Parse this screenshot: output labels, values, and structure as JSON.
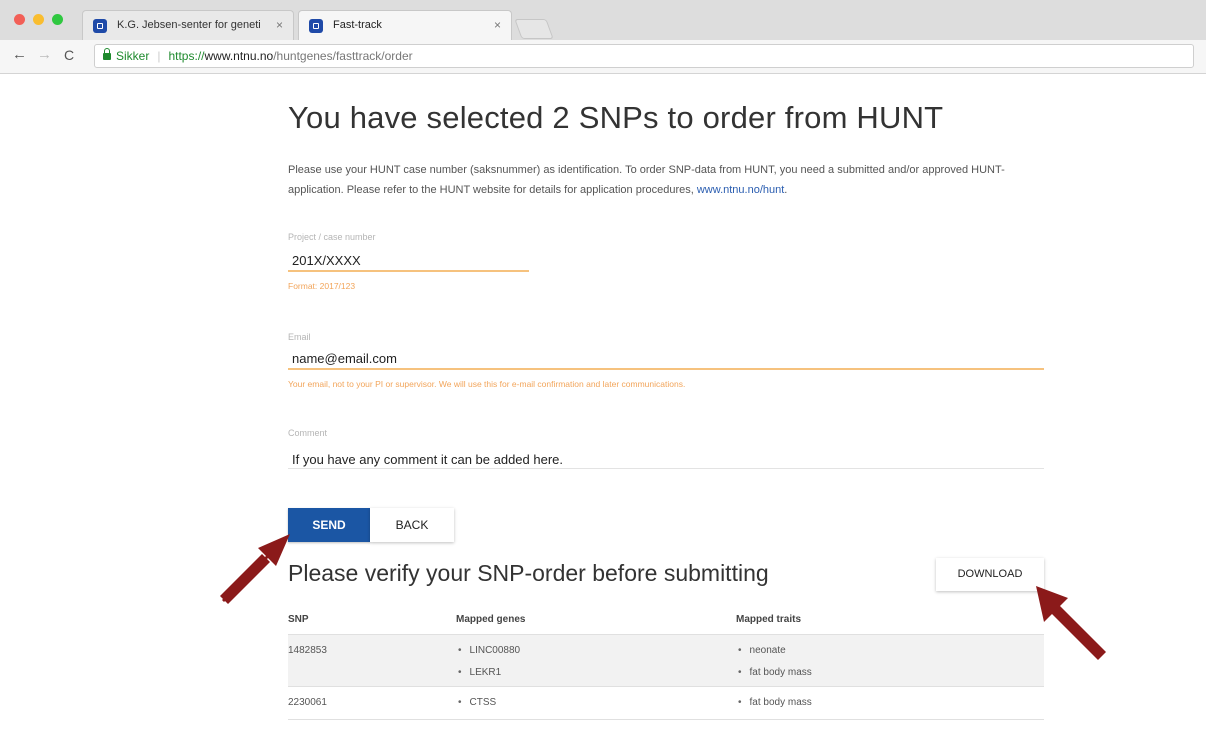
{
  "browser": {
    "tabs": [
      {
        "label": "K.G. Jebsen-senter for geneti",
        "active": false
      },
      {
        "label": "Fast-track",
        "active": true
      }
    ],
    "tab_close_glyph": "×",
    "secure_label": "Sikker",
    "url": {
      "scheme": "https://",
      "host": "www.ntnu.no",
      "path": "/huntgenes/fasttrack/order"
    }
  },
  "page": {
    "title": "You have selected 2 SNPs to order from HUNT",
    "intro_text": "Please use your HUNT case number (saksnummer) as identification. To order SNP-data from HUNT, you need a submitted and/or approved HUNT-application. Please refer to the HUNT website for details for application procedures, ",
    "intro_link": "www.ntnu.no/hunt",
    "intro_end": "."
  },
  "form": {
    "project": {
      "label": "Project / case number",
      "value": "201X/XXXX",
      "hint": "Format: 2017/123"
    },
    "email": {
      "label": "Email",
      "value": "name@email.com",
      "hint": "Your email, not to your PI or supervisor. We will use this for e-mail confirmation and later communications."
    },
    "comment": {
      "label": "Comment",
      "value": "If you have any comment it can be added here."
    },
    "send_label": "SEND",
    "back_label": "BACK"
  },
  "verify": {
    "title": "Please verify your SNP-order before submitting",
    "download_label": "DOWNLOAD",
    "columns": [
      "SNP",
      "Mapped genes",
      "Mapped traits"
    ],
    "rows": [
      {
        "snp": "1482853",
        "genes": [
          "LINC00880",
          "LEKR1"
        ],
        "traits": [
          "neonate",
          "fat body mass"
        ]
      },
      {
        "snp": "2230061",
        "genes": [
          "CTSS"
        ],
        "traits": [
          "fat body mass"
        ]
      }
    ]
  },
  "colors": {
    "primary_button": "#1b56a4",
    "field_accent": "#f6c27e",
    "hint_text": "#f2a55b",
    "annotation_arrow": "#8b1a1a"
  }
}
